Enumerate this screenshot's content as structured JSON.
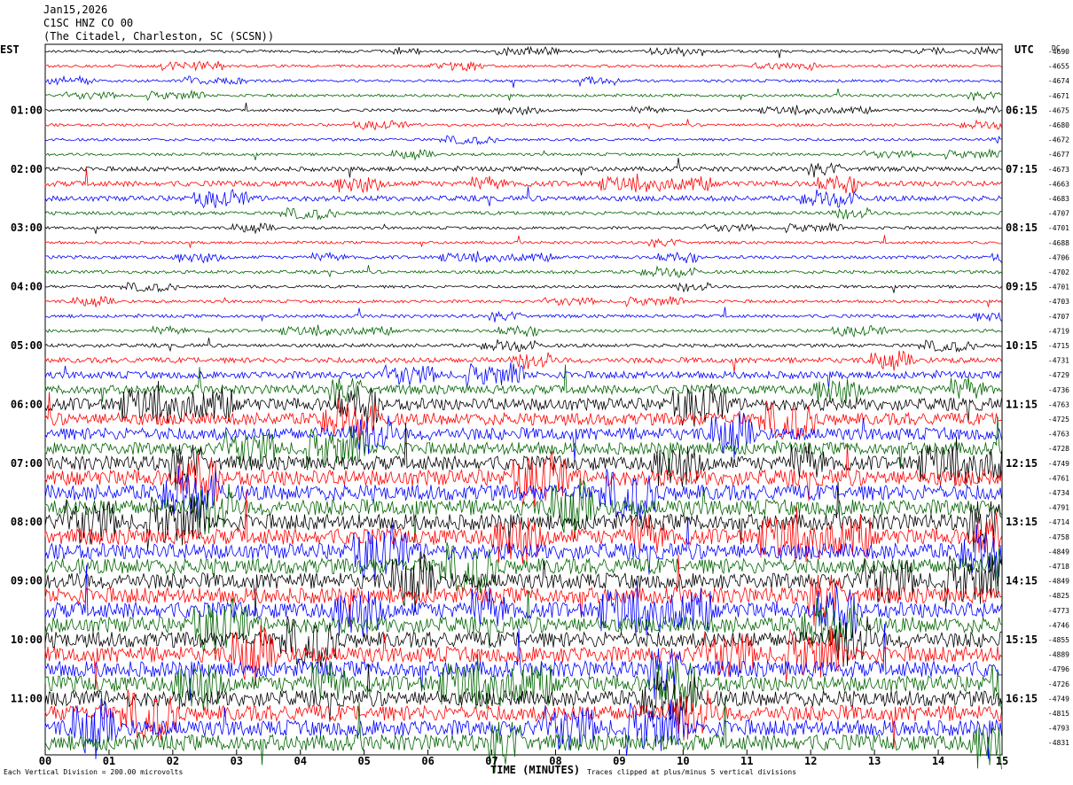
{
  "header": {
    "date": "Jan15,2026",
    "station": "C1SC HNZ CO 00",
    "location": "(The Citadel, Charleston, SC (SCSN))"
  },
  "labels": {
    "left_zone": "EST",
    "right_zone": "UTC",
    "dc_header": "DC"
  },
  "footer": {
    "scale_note": "Each Vertical Division = 200.00 microvolts",
    "clip_note": "Traces clipped at plus/minus 5 vertical divisions",
    "corner_mark": "A"
  },
  "chart_data": {
    "type": "line",
    "subtype": "helicorder-seismogram",
    "xlabel": "TIME (MINUTES)",
    "xlim": [
      0,
      15
    ],
    "x_ticks": [
      "00",
      "01",
      "02",
      "03",
      "04",
      "05",
      "06",
      "07",
      "08",
      "09",
      "10",
      "11",
      "12",
      "13",
      "14",
      "15"
    ],
    "rows_per_hour": 4,
    "minutes_per_row": 15,
    "trace_colors": [
      "#000000",
      "#ff0000",
      "#0000ff",
      "#006400"
    ],
    "est_hour_labels": [
      "01:00",
      "02:00",
      "03:00",
      "04:00",
      "05:00",
      "06:00",
      "07:00",
      "08:00",
      "09:00",
      "10:00",
      "11:00"
    ],
    "utc_labels": [
      "06:15",
      "07:15",
      "08:15",
      "09:15",
      "10:15",
      "11:15",
      "12:15",
      "13:15",
      "14:15",
      "15:15",
      "16:15"
    ],
    "dc_offsets": [
      "-4690",
      "-4655",
      "-4674",
      "-4671",
      "-4675",
      "-4680",
      "-4672",
      "-4677",
      "-4673",
      "-4663",
      "-4683",
      "-4707",
      "-4701",
      "-4688",
      "-4706",
      "-4702",
      "-4701",
      "-4703",
      "-4707",
      "-4719",
      "-4715",
      "-4731",
      "-4729",
      "-4736",
      "-4763",
      "-4725",
      "-4763",
      "-4728",
      "-4749",
      "-4761",
      "-4734",
      "-4791",
      "-4714",
      "-4758",
      "-4849",
      "-4718",
      "-4849",
      "-4825",
      "-4773",
      "-4746",
      "-4855",
      "-4889",
      "-4796",
      "-4726",
      "-4749",
      "-4815",
      "-4793",
      "-4831"
    ],
    "row_amplitudes": [
      1.5,
      1.5,
      1.5,
      1.5,
      1.5,
      1.5,
      1.5,
      1.5,
      2.5,
      3,
      3,
      2,
      1.5,
      1.5,
      1.8,
      1.8,
      1.6,
      1.6,
      1.8,
      1.8,
      2,
      3,
      4,
      5,
      7,
      7,
      7,
      7,
      8,
      9,
      9,
      9,
      9,
      9,
      9,
      9,
      9,
      9,
      9,
      9,
      9,
      9,
      9,
      9,
      9,
      9,
      9,
      9
    ]
  }
}
